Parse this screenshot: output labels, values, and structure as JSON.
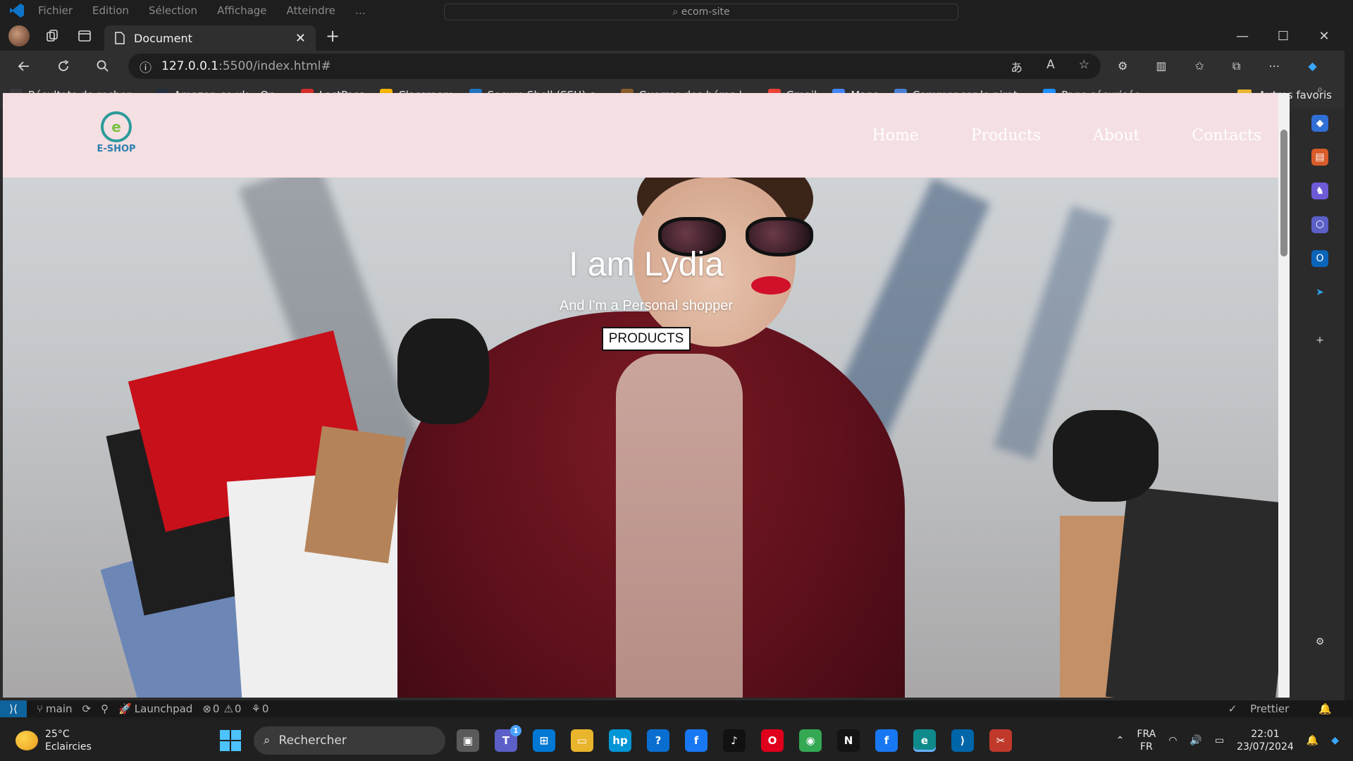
{
  "vscode": {
    "menu": [
      "Fichier",
      "Edition",
      "Sélection",
      "Affichage",
      "Atteindre",
      "…"
    ],
    "search": "ecom-site"
  },
  "browser": {
    "tab_title": "Document",
    "url_host": "127.0.0.1",
    "url_path": ":5500/index.html#",
    "bookmarks": [
      {
        "label": "Résultats de recher...",
        "icon": "page-icon",
        "color": "#3a3a3a"
      },
      {
        "label": "Amazon.co.uk – On...",
        "icon": "amazon-icon",
        "color": "#232f3e"
      },
      {
        "label": "LastPass",
        "icon": "lastpass-icon",
        "color": "#d32d27"
      },
      {
        "label": "Classroom",
        "icon": "classroom-icon",
        "color": "#f4b400"
      },
      {
        "label": "Secure Shell (SSH) c...",
        "icon": "wordpress-icon",
        "color": "#1e73be"
      },
      {
        "label": "Guerres des héros |...",
        "icon": "game-icon",
        "color": "#8a5a2b"
      },
      {
        "label": "Gmail",
        "icon": "google-icon",
        "color": "#ea4335"
      },
      {
        "label": "Maps",
        "icon": "google-icon",
        "color": "#4285f4"
      },
      {
        "label": "Commencer le pirat...",
        "icon": "translate-icon",
        "color": "#4a7fd6"
      },
      {
        "label": "Page sécurisée",
        "icon": "skype-icon",
        "color": "#1e90ff"
      }
    ],
    "other_favorites": "Autres favoris"
  },
  "site": {
    "logo_text": "E-SHOP",
    "nav": [
      "Home",
      "Products",
      "About",
      "Contacts"
    ],
    "hero_title": "I am Lydia",
    "hero_subtitle": "And I'm a Personal shopper",
    "hero_button": "PRODUCTS",
    "colors": {
      "header_bg": "#f4dfe3",
      "nav_text": "#ffffff"
    }
  },
  "statusbar": {
    "branch": "main",
    "launchpad": "Launchpad",
    "errors": "0",
    "warnings": "0",
    "ports": "0",
    "prettier": "Prettier"
  },
  "taskbar": {
    "temperature": "25°C",
    "weather": "Eclaircies",
    "search_placeholder": "Rechercher",
    "lang_top": "FRA",
    "lang_bottom": "FR",
    "time": "22:01",
    "date": "23/07/2024",
    "teams_badge": "1",
    "apps": [
      {
        "name": "task-view",
        "color": "#5a5a5a",
        "glyph": "▣"
      },
      {
        "name": "teams",
        "color": "#5b5fc7",
        "glyph": "T"
      },
      {
        "name": "store",
        "color": "#0078d4",
        "glyph": "⊞"
      },
      {
        "name": "explorer",
        "color": "#e8b52c",
        "glyph": "▭"
      },
      {
        "name": "myhp",
        "color": "#0096d6",
        "glyph": "hp"
      },
      {
        "name": "help",
        "color": "#0a6ed1",
        "glyph": "?"
      },
      {
        "name": "facebook",
        "color": "#1877f2",
        "glyph": "f"
      },
      {
        "name": "tiktok",
        "color": "#111111",
        "glyph": "♪"
      },
      {
        "name": "opera",
        "color": "#e0001b",
        "glyph": "O"
      },
      {
        "name": "chrome",
        "color": "#34a853",
        "glyph": "◉"
      },
      {
        "name": "netflix",
        "color": "#141414",
        "glyph": "N"
      },
      {
        "name": "facebook-2",
        "color": "#1877f2",
        "glyph": "f"
      },
      {
        "name": "edge",
        "color": "#0f8a8a",
        "glyph": "e"
      },
      {
        "name": "vscode",
        "color": "#0065a9",
        "glyph": "⟩"
      },
      {
        "name": "snipping",
        "color": "#c0392b",
        "glyph": "✂"
      }
    ]
  }
}
